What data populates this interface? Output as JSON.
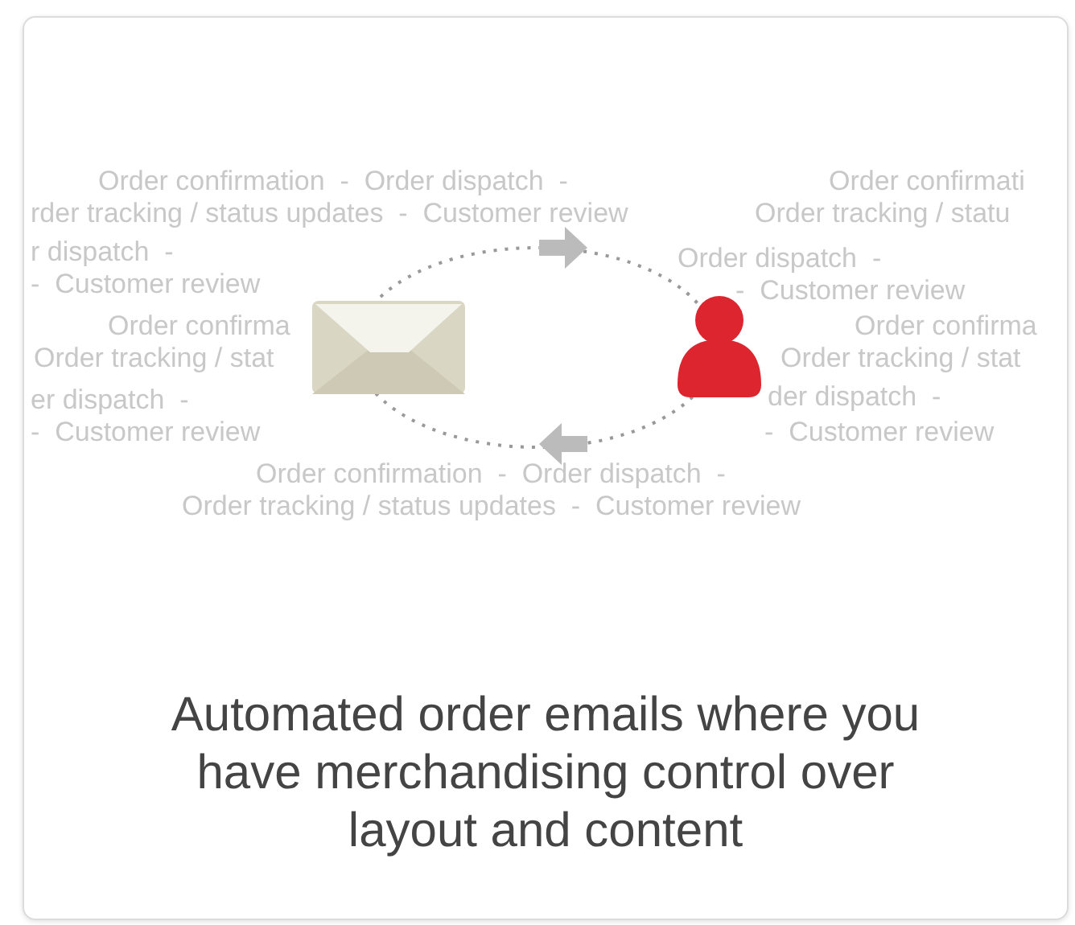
{
  "illustration": {
    "background_texts": [
      {
        "text": "Order confirmation  -  Order dispatch  -"
      },
      {
        "text": "Order confirmati"
      },
      {
        "text": "rder tracking / status updates  -  Customer review"
      },
      {
        "text": "Order tracking / statu"
      },
      {
        "text": "r dispatch  -"
      },
      {
        "text": "Order dispatch  -"
      },
      {
        "text": "-  Customer review"
      },
      {
        "text": "-  Customer review"
      },
      {
        "text": "Order confirma"
      },
      {
        "text": "Order confirma"
      },
      {
        "text": "Order tracking / stat"
      },
      {
        "text": "Order tracking / stat"
      },
      {
        "text": "er dispatch  -"
      },
      {
        "text": "der dispatch  -"
      },
      {
        "text": "-  Customer review"
      },
      {
        "text": "-  Customer review"
      },
      {
        "text": "Order confirmation  -  Order dispatch  -"
      },
      {
        "text": "Order tracking / status updates  -  Customer review"
      }
    ]
  },
  "caption": "Automated order emails where you have merchandising control over layout and content"
}
